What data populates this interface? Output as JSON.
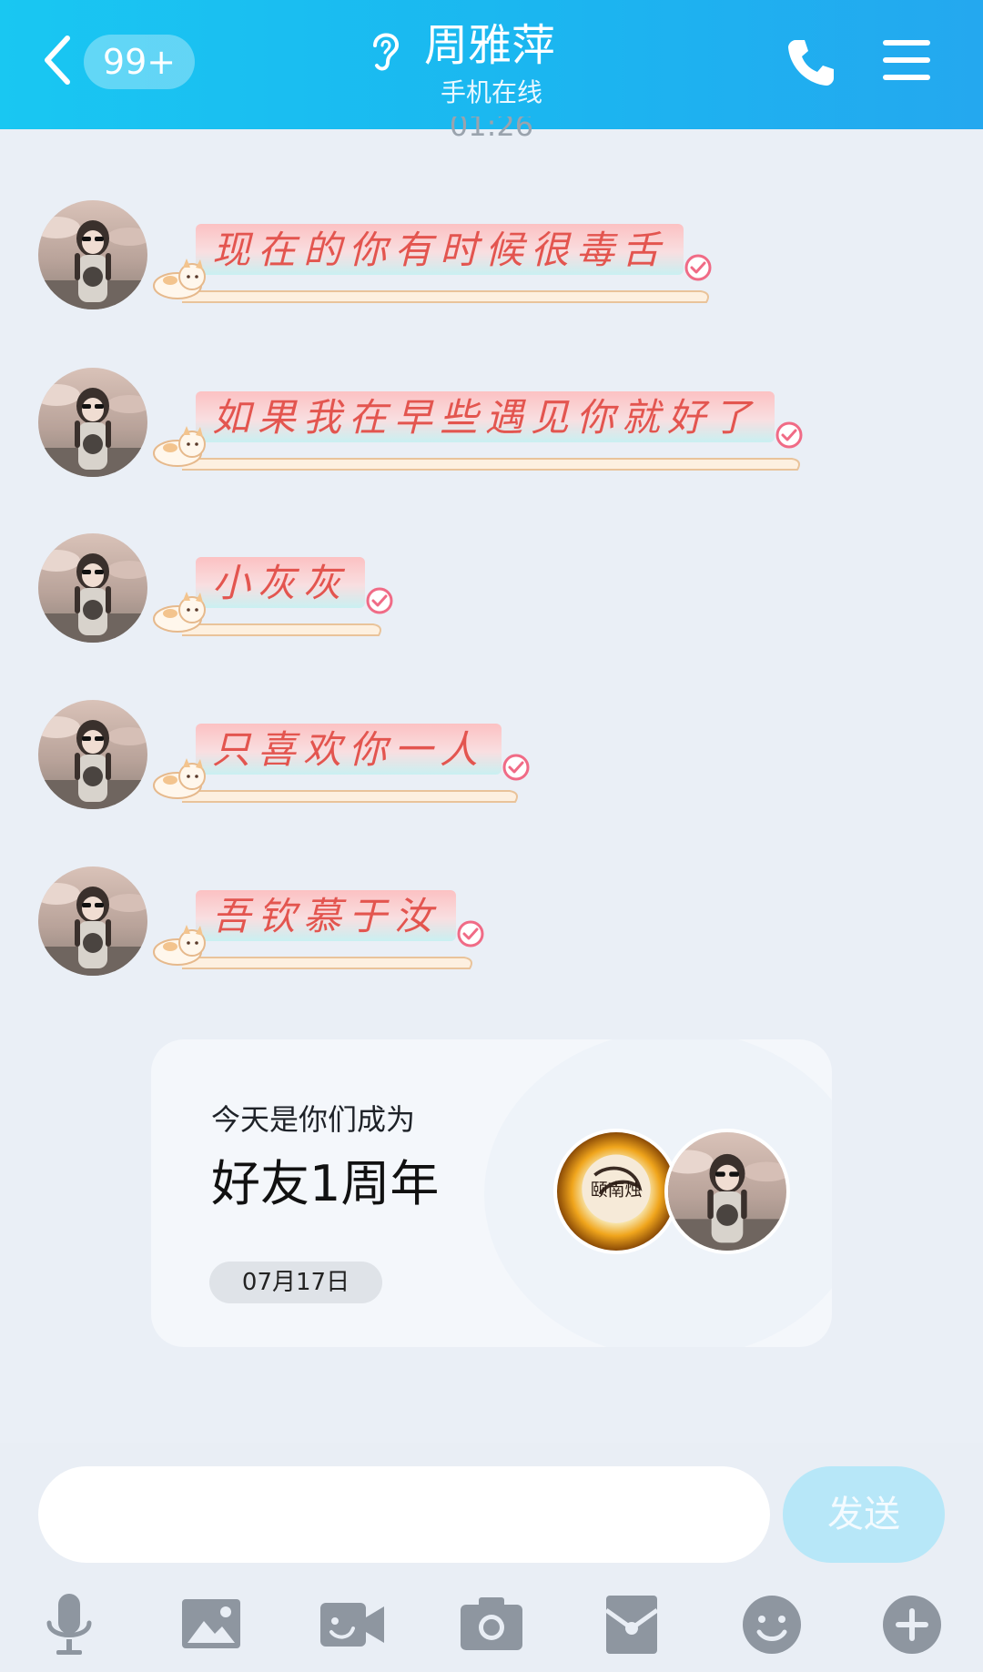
{
  "header": {
    "unread_badge": "99+",
    "contact_name": "周雅萍",
    "status": "手机在线"
  },
  "timestamp": "01:26",
  "messages": [
    {
      "text": "现在的你有时候很毒舌"
    },
    {
      "text": "如果我在早些遇见你就好了"
    },
    {
      "text": "小灰灰"
    },
    {
      "text": "只喜欢你一人"
    },
    {
      "text": "吾钦慕于汝"
    }
  ],
  "card": {
    "line1": "今天是你们成为",
    "line2": "好友1周年",
    "date": "07月17日",
    "avatar_text": "颐南烛"
  },
  "input": {
    "placeholder": "",
    "send_label": "发送"
  },
  "toolbar": [
    "voice-icon",
    "image-icon",
    "video-call-icon",
    "camera-icon",
    "red-packet-icon",
    "emoji-icon",
    "more-icon"
  ],
  "colors": {
    "header": "#1bb6f0",
    "message_text": "#e3554f",
    "icon_gray": "#8e96a0",
    "send_button": "#b7e7f8"
  }
}
